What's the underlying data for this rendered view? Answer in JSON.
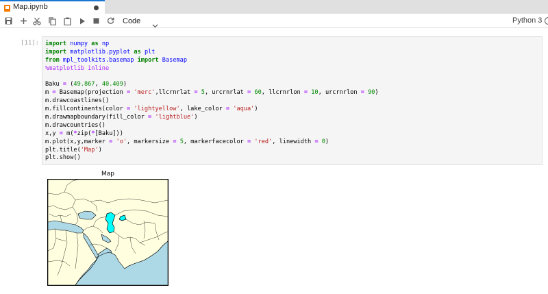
{
  "tab": {
    "title": "Map.ipynb",
    "modified_icon": "dot-icon"
  },
  "toolbar": {
    "buttons": [
      {
        "name": "save",
        "icon": "save-icon"
      },
      {
        "name": "insert-cell",
        "icon": "plus-icon"
      },
      {
        "name": "cut",
        "icon": "scissors-icon"
      },
      {
        "name": "copy",
        "icon": "copy-icon"
      },
      {
        "name": "paste",
        "icon": "clipboard-icon"
      },
      {
        "name": "run",
        "icon": "play-icon"
      },
      {
        "name": "interrupt",
        "icon": "stop-icon"
      },
      {
        "name": "restart",
        "icon": "refresh-icon"
      }
    ],
    "cell_type": "Code",
    "kernel_name": "Python 3"
  },
  "cell": {
    "prompt": "[11]:",
    "code_lines": [
      "import numpy as np",
      "import matplotlib.pyplot as plt",
      "from mpl_toolkits.basemap import Basemap",
      "%matplotlib inline",
      "",
      "Baku = (49.867, 40.409)",
      "m = Basemap(projection = 'merc',llcrnrlat = 5, urcrnrlat = 60, llcrnrlon = 10, urcrnrlon = 90)",
      "m.drawcoastlines()",
      "m.fillcontinents(color = 'lightyellow', lake_color = 'aqua')",
      "m.drawmapboundary(fill_color = 'lightblue')",
      "m.drawcountries()",
      "x,y = m(*zip(*[Baku]))",
      "m.plot(x,y,marker = 'o', markersize = 5, markerfacecolor = 'red', linewidth = 0)",
      "plt.title('Map')",
      "plt.show()"
    ]
  },
  "output": {
    "figure_title": "Map",
    "colors": {
      "land": "#ffffe0",
      "ocean": "#add8e6",
      "lake": "#00ffff",
      "border": "#000000"
    }
  }
}
